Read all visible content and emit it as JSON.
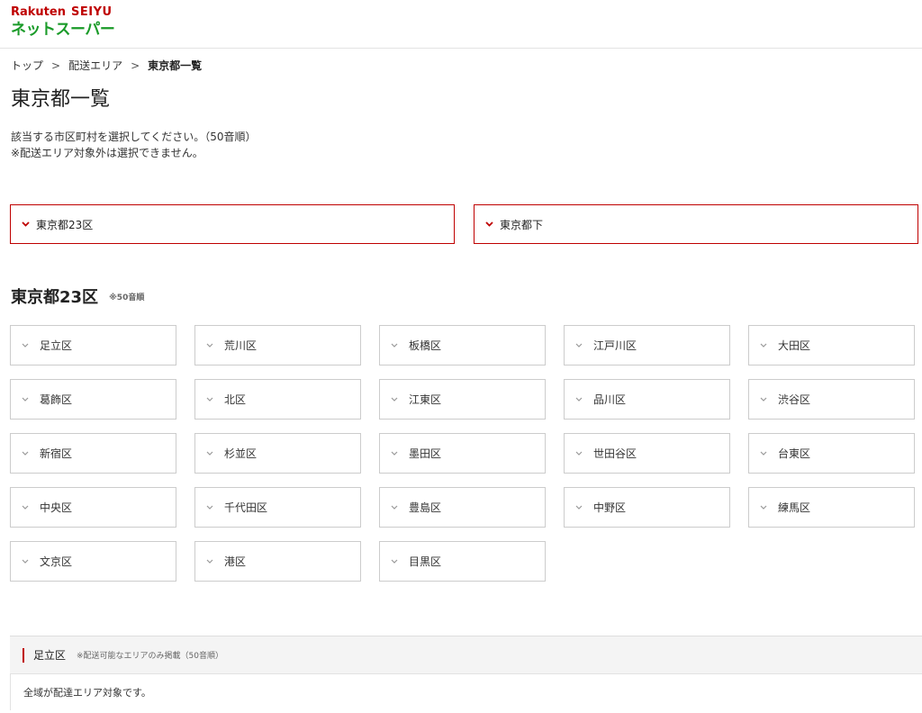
{
  "header": {
    "logo_rakuten": "Rakuten",
    "logo_seiyu": "SEIYU",
    "logo_subtitle": "ネットスーパー"
  },
  "breadcrumb": {
    "items": [
      "トップ",
      "配送エリア"
    ],
    "current": "東京都一覧",
    "separator": ">"
  },
  "page_title": "東京都一覧",
  "intro": {
    "line1": "該当する市区町村を選択してください。（50音順）",
    "line2": "※配送エリア対象外は選択できません。"
  },
  "region_tabs": [
    {
      "label": "東京都23区",
      "icon": "chevron-down-icon"
    },
    {
      "label": "東京都下",
      "icon": "chevron-down-icon"
    }
  ],
  "section": {
    "title": "東京都23区",
    "note": "※50音順"
  },
  "wards": [
    "足立区",
    "荒川区",
    "板橋区",
    "江戸川区",
    "大田区",
    "葛飾区",
    "北区",
    "江東区",
    "品川区",
    "渋谷区",
    "新宿区",
    "杉並区",
    "墨田区",
    "世田谷区",
    "台東区",
    "中央区",
    "千代田区",
    "豊島区",
    "中野区",
    "練馬区",
    "文京区",
    "港区",
    "目黒区"
  ],
  "detail": {
    "name": "足立区",
    "note": "※配送可能なエリアのみ掲載（50音順）",
    "body": "全域が配達エリア対象です。"
  },
  "colors": {
    "brand_red": "#bf0000",
    "brand_green": "#1a9b29",
    "border_gray": "#cccccc"
  }
}
